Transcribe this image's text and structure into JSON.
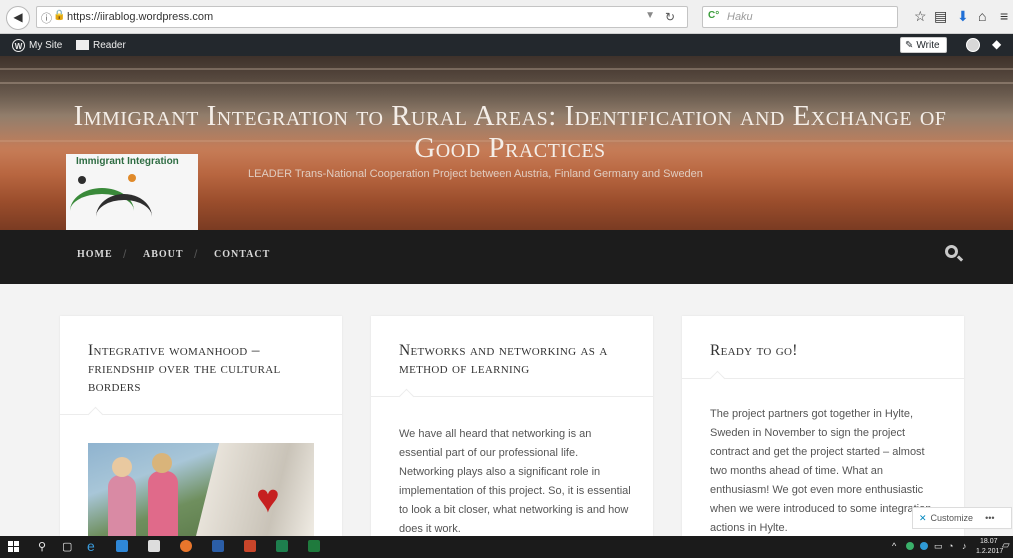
{
  "browser": {
    "url": "https://iirablog.wordpress.com",
    "search_placeholder": "Haku",
    "search_engine": "Haku"
  },
  "adminbar": {
    "my_site": "My Site",
    "reader": "Reader",
    "write": "Write"
  },
  "header": {
    "title": "Immigrant Integration to Rural Areas: Identification and Exchange of Good Practices",
    "description": "LEADER Trans-National Cooperation Project between Austria, Finland Germany and Sweden",
    "logo_text": "Immigrant Integration"
  },
  "nav": {
    "items": [
      {
        "label": "HOME"
      },
      {
        "label": "ABOUT"
      },
      {
        "label": "CONTACT"
      }
    ],
    "separator": "/"
  },
  "posts": [
    {
      "title": "Integrative womanhood – friendship over the cultural borders",
      "excerpt": ""
    },
    {
      "title": "Networks and networking as a method of learning",
      "excerpt": "We have all heard that networking is an essential part of our professional life. Networking plays also a significant role in implementation of this project. So, it is essential to look a bit closer, what networking is and how does it work."
    },
    {
      "title": "Ready to go!",
      "excerpt": "The project partners got together in Hylte, Sweden in November to sign the project contract and get the project started – almost two months ahead of time. What an enthusiasm! We got even more enthusiastic when we were introduced to some integration actions in Hylte."
    }
  ],
  "customize": {
    "label": "Customize",
    "more": "•••"
  },
  "taskbar": {
    "time": "18.07",
    "date": "1.2.2017"
  },
  "colors": {
    "adminbar": "#23282d",
    "navbar": "#1c1c1c",
    "page_bg": "#f3f3f3",
    "card_bg": "#ffffff",
    "heart": "#c62020"
  }
}
